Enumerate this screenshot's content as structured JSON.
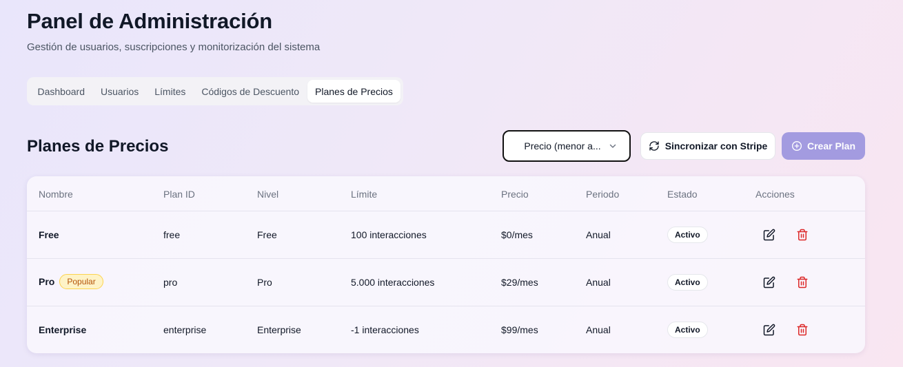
{
  "header": {
    "title": "Panel de Administración",
    "subtitle": "Gestión de usuarios, suscripciones y monitorización del sistema"
  },
  "tabs": [
    {
      "label": "Dashboard",
      "active": false
    },
    {
      "label": "Usuarios",
      "active": false
    },
    {
      "label": "Límites",
      "active": false
    },
    {
      "label": "Códigos de Descuento",
      "active": false
    },
    {
      "label": "Planes de Precios",
      "active": true
    }
  ],
  "section": {
    "title": "Planes de Precios",
    "sort_value": "Precio (menor a...",
    "sync_label": "Sincronizar con Stripe",
    "create_label": "Crear Plan"
  },
  "table": {
    "columns": [
      "Nombre",
      "Plan ID",
      "Nivel",
      "Límite",
      "Precio",
      "Periodo",
      "Estado",
      "Acciones"
    ],
    "rows": [
      {
        "name": "Free",
        "badge": "",
        "plan_id": "free",
        "level": "Free",
        "limit": "100 interacciones",
        "price": "$0/mes",
        "period": "Anual",
        "status": "Activo"
      },
      {
        "name": "Pro",
        "badge": "Popular",
        "plan_id": "pro",
        "level": "Pro",
        "limit": "5.000 interacciones",
        "price": "$29/mes",
        "period": "Anual",
        "status": "Activo"
      },
      {
        "name": "Enterprise",
        "badge": "",
        "plan_id": "enterprise",
        "level": "Enterprise",
        "limit": "-1 interacciones",
        "price": "$99/mes",
        "period": "Anual",
        "status": "Activo"
      }
    ]
  },
  "icons": {
    "edit": "edit-icon",
    "delete": "trash-icon",
    "sync": "refresh-icon",
    "create": "plus-circle-icon",
    "sort": "chevron-down-icon"
  },
  "colors": {
    "accent": "#a39be0",
    "delete": "#dc2626",
    "popular_text": "#b45309",
    "popular_bg": "#fef3c7"
  }
}
